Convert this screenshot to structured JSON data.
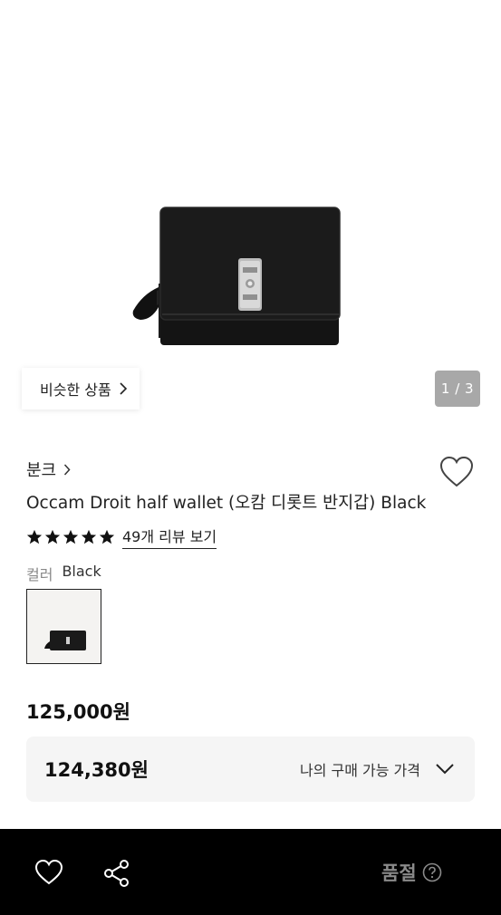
{
  "gallery": {
    "similar_label": "비슷한 상품",
    "pager": "1 / 3"
  },
  "product": {
    "brand": "분크",
    "title": "Occam Droit half wallet (오캄 디롯트 반지갑) Black",
    "rating_stars": 5,
    "review_link": "49개 리뷰 보기",
    "color_label": "컬러",
    "color_value": "Black",
    "price": "125,000원"
  },
  "my_price": {
    "amount": "124,380원",
    "label": "나의 구매 가능 가격"
  },
  "bottom_bar": {
    "status": "품절"
  },
  "icons": [
    "heart-icon",
    "share-icon",
    "chevron-right-icon",
    "chevron-down-icon",
    "star-icon",
    "question-circle-icon"
  ],
  "colors": {
    "bottom_bar_bg": "#000000",
    "pager_bg": "#a8a8a8",
    "my_price_bg": "#f5f5f5",
    "soldout_text": "#8a8a8a"
  }
}
